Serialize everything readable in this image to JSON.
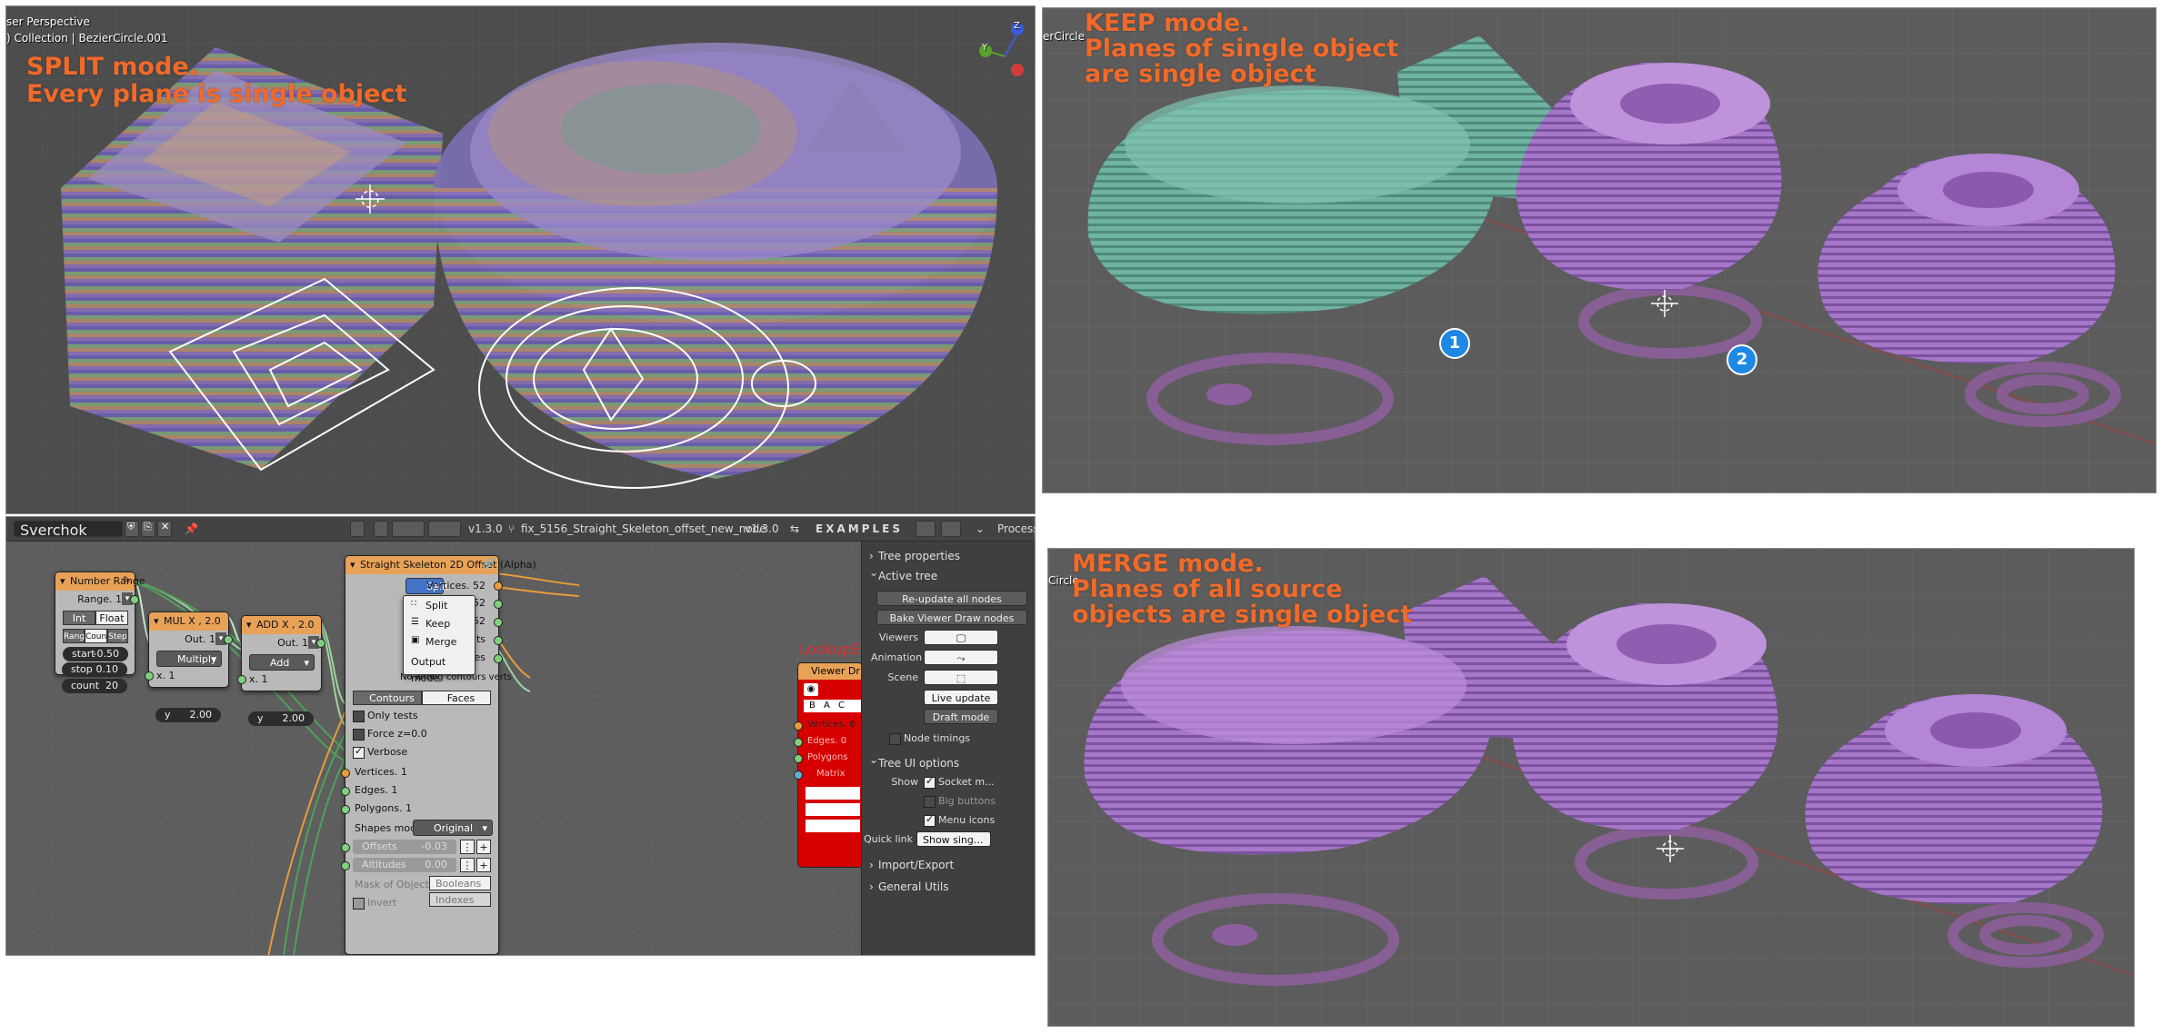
{
  "panels": {
    "split": {
      "viewport_mode": "ser Perspective",
      "viewport_collection": ") Collection | BezierCircle.001",
      "title_line1": "SPLIT mode.",
      "title_line2": "Every plane is single object",
      "gizmo_labels": {
        "z": "Z",
        "y": "Y"
      }
    },
    "keep": {
      "object_name": "erCircle",
      "title_line1": "KEEP mode.",
      "title_line2": "Planes of single object",
      "title_line3": "are single object",
      "badge1": "1",
      "badge2": "2"
    },
    "merge": {
      "object_name": "Circle",
      "title_line1": "MERGE mode.",
      "title_line2": "Planes of all source",
      "title_line3": "objects are single object"
    }
  },
  "node_editor": {
    "header": {
      "tree_name": "Sverchok Nodes",
      "version_left": "v1.3.0",
      "branch": "fix_5156_Straight_Skeleton_offset_new_node",
      "version_right": "v1.3.0",
      "examples": "EXAMPLES",
      "process": "Process"
    },
    "number_range": {
      "title": "Number Range",
      "output": "Range. 1",
      "mode_int": "Int",
      "mode_float": "Float",
      "tab_range": "Range",
      "tab_count": "Count",
      "tab_step": "Step",
      "start_label": "start",
      "start_value": "-0.50",
      "stop_label": "stop",
      "stop_value": "0.10",
      "count_label": "count",
      "count_value": "20"
    },
    "mul": {
      "title": "MUL X , 2.0",
      "output": "Out. 1",
      "op": "Multiply",
      "x": "x. 1",
      "y_label": "y",
      "y_value": "2.00"
    },
    "add": {
      "title": "ADD X , 2.0",
      "output": "Out. 1",
      "op": "Add",
      "x": "x. 1",
      "y_label": "y",
      "y_value": "2.00"
    },
    "skeleton": {
      "title": "Straight Skeleton 2D Offset (Alpha)",
      "mode_selected": "Split",
      "out_vertices": "Vertices. 52",
      "out_v2": "52",
      "out_v3": "52",
      "out_v4": "ts",
      "out_v5": "es",
      "warning": "No wrong contours verts",
      "tab_contours": "Contours",
      "tab_faces": "Faces",
      "opt_only_tests": "Only tests",
      "opt_force_z": "Force z=0.0",
      "opt_verbose": "Verbose",
      "in_vertices": "Vertices. 1",
      "in_edges": "Edges. 1",
      "in_polygons": "Polygons. 1",
      "shapes_mode_label": "Shapes mode:",
      "shapes_mode_value": "Original",
      "offsets_label": "Offsets",
      "offsets_value": "-0.03",
      "altitudes_label": "Altitudes",
      "altitudes_value": "0.00",
      "mask_label": "Mask of Objects:",
      "mask_booleans": "Booleans",
      "mask_indexes": "Indexes",
      "invert_label": "Invert"
    },
    "output_menu": {
      "items": [
        "Split",
        "Keep",
        "Merge"
      ],
      "footer": "Output mode"
    },
    "lookup_label": "LookupE",
    "viewer": {
      "title": "Viewer Dr",
      "bake": "B A C",
      "sockets": [
        "Vertices. 6",
        "Edges. 0",
        "Polygons",
        "Matrix"
      ]
    },
    "sidebar": {
      "tree_properties": "Tree properties",
      "active_tree": "Active tree",
      "reupdate": "Re-update all nodes",
      "bake_viewer": "Bake Viewer Draw nodes",
      "viewers_label": "Viewers",
      "animation_label": "Animation",
      "scene_label": "Scene",
      "live_update": "Live update",
      "draft_mode": "Draft mode",
      "node_timings": "Node timings",
      "tree_ui_options": "Tree UI options",
      "show_label": "Show",
      "socket_m": "Socket m...",
      "big_buttons": "Big buttons",
      "menu_icons": "Menu icons",
      "quick_link_label": "Quick link",
      "quick_link_value": "Show sing...",
      "import_export": "Import/Export",
      "general_utils": "General Utils"
    }
  },
  "colors": {
    "accent_orange": "#f06a2a",
    "node_header": "#e8a257",
    "viewer_red": "#d60000",
    "badge_blue": "#1e88e5",
    "teal_object": "#6fb3a2",
    "purple_object": "#a676c8"
  }
}
